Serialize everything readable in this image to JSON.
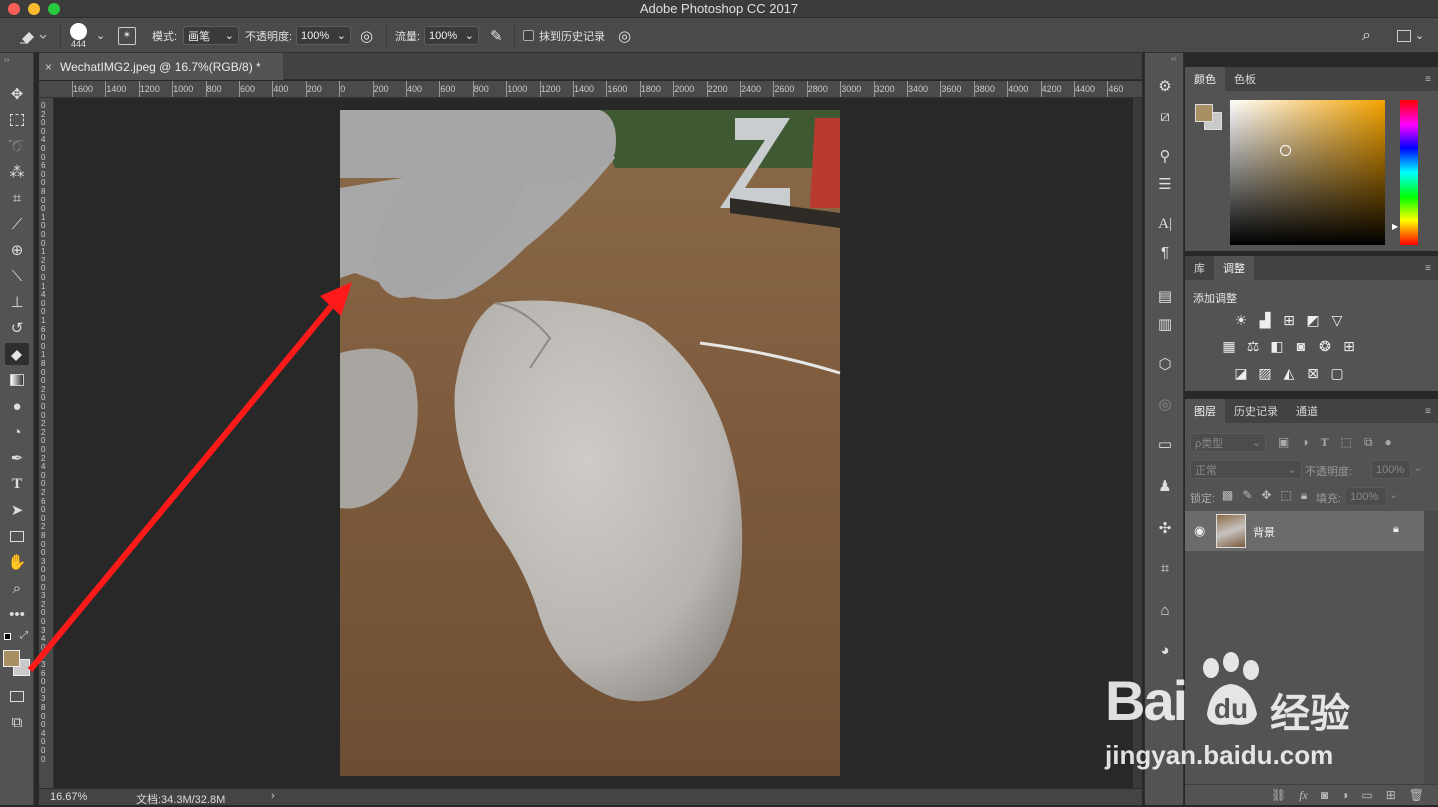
{
  "window": {
    "title": "Adobe Photoshop CC 2017"
  },
  "options_bar": {
    "brush_size": "444",
    "mode_label": "模式:",
    "mode_value": "画笔",
    "opacity_label": "不透明度:",
    "opacity_value": "100%",
    "flow_label": "流量:",
    "flow_value": "100%",
    "erase_history_label": "抹到历史记录"
  },
  "document": {
    "tab_title": "WechatIMG2.jpeg @ 16.7%(RGB/8) *",
    "zoom": "16.67%",
    "doc_size": "文档:34.3M/32.8M"
  },
  "ruler": {
    "h_ticks": [
      "1600",
      "1400",
      "1200",
      "1000",
      "800",
      "600",
      "400",
      "200",
      "0",
      "200",
      "400",
      "600",
      "800",
      "1000",
      "1200",
      "1400",
      "1600",
      "1800",
      "2000",
      "2200",
      "2400",
      "2600",
      "2800",
      "3000",
      "3200",
      "3400",
      "3600",
      "3800",
      "4000",
      "4200",
      "4400",
      "460"
    ],
    "v_ticks": [
      "0",
      "2",
      "0",
      "0",
      "4",
      "0",
      "0",
      "6",
      "0",
      "0",
      "8",
      "0",
      "0",
      "1",
      "0",
      "0",
      "0",
      "1",
      "2",
      "0",
      "0",
      "1",
      "4",
      "0",
      "0",
      "1",
      "6",
      "0",
      "0",
      "1",
      "8",
      "0",
      "0",
      "2",
      "0",
      "0",
      "0",
      "2",
      "2",
      "0",
      "0",
      "2",
      "4",
      "0",
      "0",
      "2",
      "6",
      "0",
      "0",
      "2",
      "8",
      "0",
      "0",
      "3",
      "0",
      "0",
      "0",
      "3",
      "2",
      "0",
      "0",
      "3",
      "4",
      "0",
      "0",
      "3",
      "6",
      "0",
      "0",
      "3",
      "8",
      "0",
      "0",
      "4",
      "0",
      "0",
      "0"
    ]
  },
  "color_panel": {
    "tabs": [
      "颜色",
      "色板"
    ],
    "fg_color": "#a89064",
    "bg_color": "#c9c9c9",
    "hue_color": "#f5a300"
  },
  "adjust_panel": {
    "tabs": [
      "库",
      "调整"
    ],
    "header": "添加调整"
  },
  "layers_panel": {
    "tabs": [
      "图层",
      "历史记录",
      "通道"
    ],
    "filter_label": "ρ类型",
    "blend_mode": "正常",
    "opacity_label": "不透明度:",
    "opacity_value": "100%",
    "lock_label": "锁定:",
    "fill_label": "填充:",
    "fill_value": "100%",
    "layers": [
      {
        "name": "背景",
        "locked": true,
        "visible": true
      }
    ]
  },
  "watermark": {
    "brand": "Bai",
    "brand2": "经验",
    "url": "jingyan.baidu.com"
  },
  "annotation": {
    "arrow_color": "#ff1a1a",
    "circle_color": "#e8102a"
  }
}
